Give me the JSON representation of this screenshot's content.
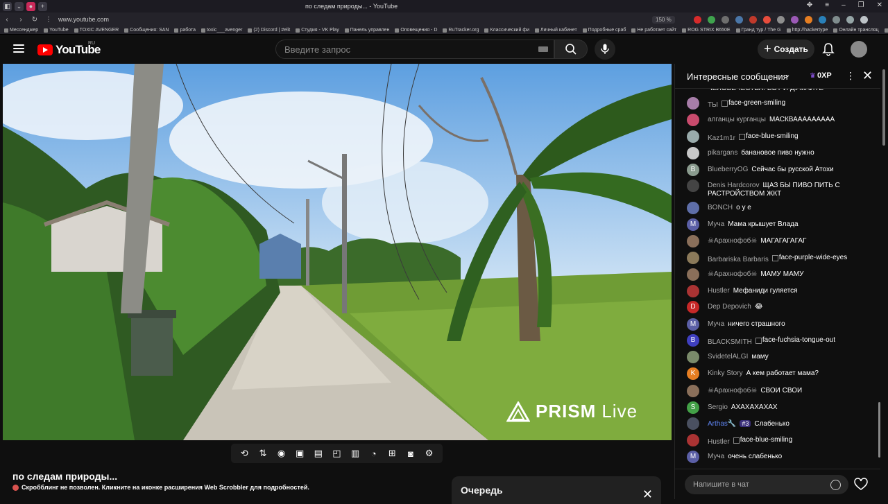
{
  "browser": {
    "url": "www.youtube.com",
    "tab_title": "по следам природы... - YouTube",
    "zoom": "150 %",
    "bookmarks": [
      "Мессенджер",
      "YouTube",
      "TOXIC AVENGER",
      "Сообщения: SAN",
      "работа",
      "toxic___avenger",
      "(2) Discord | #elit",
      "Студия - VK Play",
      "Панель управлен",
      "Оповещения - D",
      "RuTracker.org",
      "Классический фи",
      "Личный кабинет",
      "Подробные сраб",
      "Не работает сайт",
      "ROG STRIX B650E",
      "Гранд тур / The G",
      "http://hackertype",
      "Онлайн трансляц",
      "Oc"
    ]
  },
  "header": {
    "logo": "YouTube",
    "region": "RU",
    "search_placeholder": "Введите запрос",
    "create_label": "Создать"
  },
  "video": {
    "watermark_brand": "PRISM",
    "watermark_live": "Live",
    "title": "по следам природы...",
    "scrobble_notice": "Скробблинг не позволен. Кликните на иконке расширения Web Scrobbler для подробностей."
  },
  "queue": {
    "title": "Очередь"
  },
  "chat": {
    "header_title": "Интересные сообщения",
    "xp": "0XP",
    "input_placeholder": "Напишите в чат",
    "messages": [
      {
        "author": "",
        "text": "ЧЕЛОВЕЧЕСТВА. ВОТ И ДУМАЙТЕ"
      },
      {
        "author": "ТЫ",
        "text": "face-green-smiling",
        "img": true
      },
      {
        "author": "алганцы курганцы",
        "text": "МАСКВААААААААА"
      },
      {
        "author": "Kaz1m1r",
        "text": "face-blue-smiling",
        "img": true
      },
      {
        "author": "pikargans",
        "text": "банановое пиво нужно"
      },
      {
        "author": "BlueberryOG",
        "text": "Сейчас бы русской Атохи",
        "initial": "B"
      },
      {
        "author": "Denis Hardcorov",
        "text": "ЩАЗ БЫ ПИВО ПИТЬ С РАСТРОЙСТВОМ ЖКТ"
      },
      {
        "author": "BONCH",
        "text": "о у е"
      },
      {
        "author": "Муча",
        "text": "Мама крышует Влада",
        "initial": "М"
      },
      {
        "author": "☠Арахнофоб☠",
        "text": "МАГАГАГАГАГ"
      },
      {
        "author": "Barbariska Barbaris",
        "text": "face-purple-wide-eyes",
        "img": true
      },
      {
        "author": "☠Арахнофоб☠",
        "text": "МАМУ МАМУ"
      },
      {
        "author": "Hustler",
        "text": "Мефаниди гуляется"
      },
      {
        "author": "Dep Depovich",
        "text": "😂",
        "initial": "D"
      },
      {
        "author": "Муча",
        "text": "ничего страшного",
        "initial": "М"
      },
      {
        "author": "BLACKSMITH",
        "text": "face-fuchsia-tongue-out",
        "img": true,
        "initial": "B"
      },
      {
        "author": "SvidetelALGI",
        "text": "маму"
      },
      {
        "author": "Kinky Story",
        "text": "А кем работает мама?",
        "initial": "K"
      },
      {
        "author": "☠Арахнофоб☠",
        "text": "СВОИ СВОИ"
      },
      {
        "author": "Sergio",
        "text": "АХАХАХАХАХ",
        "initial": "S"
      },
      {
        "author": "Arthas🔧",
        "badge": "#3",
        "text": "Слабенько"
      },
      {
        "author": "Hustler",
        "text": "face-blue-smiling",
        "img": true
      },
      {
        "author": "Муча",
        "text": "очень слабенько",
        "initial": "М"
      }
    ]
  }
}
